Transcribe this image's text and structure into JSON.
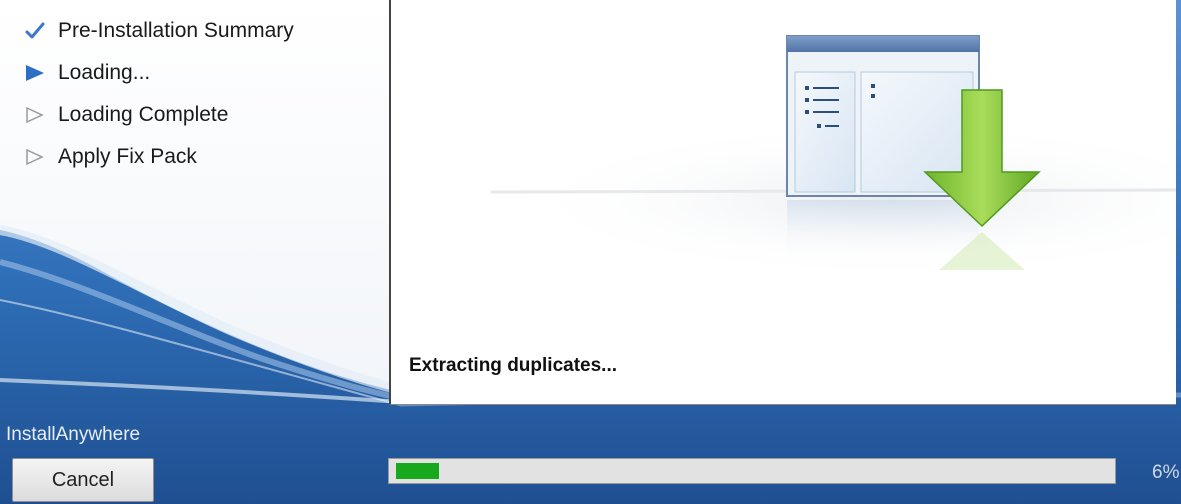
{
  "steps": [
    {
      "label": "Pre-Installation Summary",
      "state": "done",
      "icon": "checkmark-icon"
    },
    {
      "label": "Loading...",
      "state": "current",
      "icon": "filled-arrow-icon"
    },
    {
      "label": "Loading Complete",
      "state": "pending",
      "icon": "outline-arrow-icon"
    },
    {
      "label": "Apply Fix Pack",
      "state": "pending",
      "icon": "outline-arrow-icon"
    }
  ],
  "panel": {
    "status_text": "Extracting duplicates...",
    "illustration": "window-download-icon"
  },
  "footer": {
    "brand": "InstallAnywhere",
    "cancel_label": "Cancel",
    "progress_percent_text": "6%",
    "progress_fraction": 0.06
  },
  "colors": {
    "background_blue": "#2f6fb8",
    "progress_green": "#17a81b",
    "check_blue": "#3a78c9",
    "download_arrow_green": "#7cc33c"
  }
}
